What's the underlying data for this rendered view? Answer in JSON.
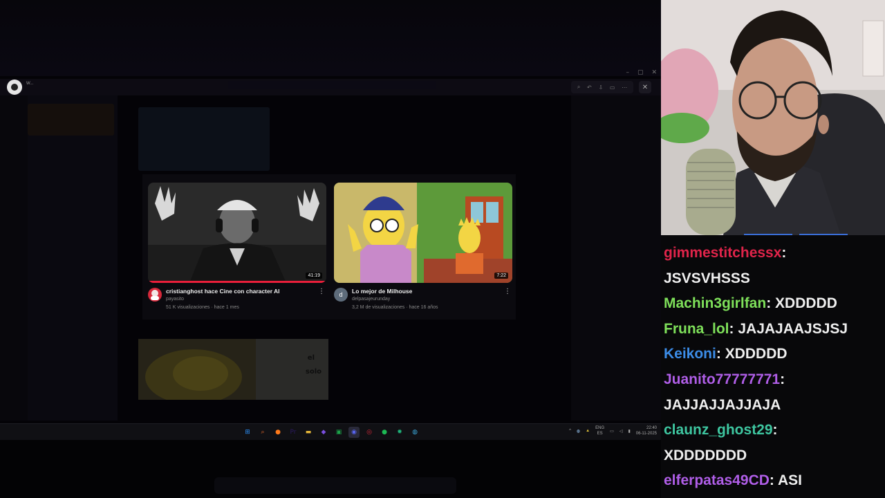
{
  "viewer": {
    "app_short": "W...",
    "win_controls": [
      "–",
      "▢",
      "✕"
    ],
    "toolbar_icons": [
      "⌕",
      "↶",
      "⇩",
      "▭",
      "⋯"
    ],
    "close_icon": "✕"
  },
  "videos": [
    {
      "title": "cristianghost hace Cine con character AI",
      "channel": "payasito",
      "stats": "51 K visualizaciones · hace 1 mes",
      "duration": "41:19",
      "avatar_color": "#d6283a"
    },
    {
      "title": "Lo mejor de Milhouse",
      "channel": "delpasajeurunday",
      "stats": "3,2 M de visualizaciones · hace 16 años",
      "duration": "7:22",
      "avatar_letter": "d",
      "avatar_color": "#5d6b7a"
    }
  ],
  "third_thumb": {
    "line1": "el",
    "line2": "solo"
  },
  "taskbar": {
    "icons": [
      {
        "name": "windows-start-icon",
        "glyph": "⊞",
        "color": "#2b8cf0"
      },
      {
        "name": "search-icon",
        "glyph": "⌕",
        "color": "#e8692c"
      },
      {
        "name": "firefox-icon",
        "glyph": "●",
        "color": "#ff7a1a"
      },
      {
        "name": "premiere-icon",
        "glyph": "Pr",
        "color": "#2a1a5e"
      },
      {
        "name": "folder-icon",
        "glyph": "▬",
        "color": "#e8b93a"
      },
      {
        "name": "obsidian-icon",
        "glyph": "◆",
        "color": "#7b4fe0"
      },
      {
        "name": "green-app-icon",
        "glyph": "▣",
        "color": "#1ca34a"
      },
      {
        "name": "discord-icon",
        "glyph": "◉",
        "color": "#5865f2"
      },
      {
        "name": "red-app-icon",
        "glyph": "◎",
        "color": "#d6283a"
      },
      {
        "name": "spotify-icon",
        "glyph": "●",
        "color": "#1db954"
      },
      {
        "name": "gear-app-icon",
        "glyph": "✹",
        "color": "#1fb37a"
      },
      {
        "name": "browser-icon",
        "glyph": "◍",
        "color": "#3ba7d9"
      }
    ],
    "tray_caret": "^",
    "lang_top": "ENG",
    "lang_bottom": "ES",
    "time": "22:40",
    "date": "06-11-2025"
  },
  "chat": [
    {
      "user": "gimmestitchessx",
      "sep": ":",
      "message": "",
      "color": "#e0244a"
    },
    {
      "user": "",
      "sep": "",
      "message": "JSVSVHSSS",
      "color": "#efefef"
    },
    {
      "user": "Machin3girlfan",
      "sep": ": ",
      "message": "XDDDDD",
      "color": "#7ee05a"
    },
    {
      "user": "Fruna_lol",
      "sep": ": ",
      "message": "JAJAJAAJSJSJ",
      "color": "#7ee05a"
    },
    {
      "user": "Keikoni",
      "sep": ": ",
      "message": "XDDDDD",
      "color": "#3c8de8"
    },
    {
      "user": "Juanito77777771",
      "sep": ":",
      "message": "",
      "color": "#b05ee8"
    },
    {
      "user": "",
      "sep": "",
      "message": "JAJJAJJAJJAJA",
      "color": "#efefef"
    },
    {
      "user": "claunz_ghost29",
      "sep": ":",
      "message": "",
      "color": "#3ec6a0"
    },
    {
      "user": "",
      "sep": "",
      "message": "XDDDDDDD",
      "color": "#efefef"
    },
    {
      "user": "elferpatas49CD",
      "sep": ": ",
      "message": "ASI",
      "color": "#b05ee8"
    }
  ]
}
